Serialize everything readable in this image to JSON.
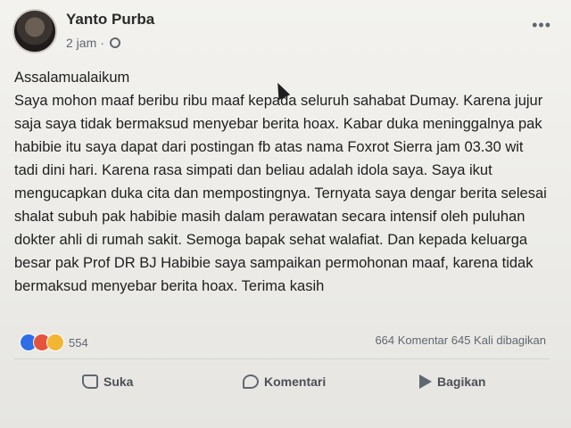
{
  "post": {
    "author": "Yanto Purba",
    "time": "2 jam",
    "more": "•••",
    "text": "Assalamualaikum\nSaya mohon maaf beribu ribu maaf kepada seluruh sahabat Dumay. Karena jujur saja saya tidak bermaksud menyebar berita hoax. Kabar duka meninggalnya pak habibie itu saya dapat dari postingan fb atas nama Foxrot Sierra jam 03.30 wit tadi dini hari. Karena rasa simpati dan beliau adalah idola saya. Saya ikut mengucapkan duka cita dan mempostingnya. Ternyata saya dengar berita selesai shalat subuh pak habibie masih dalam perawatan secara intensif oleh puluhan dokter ahli di rumah sakit. Semoga bapak sehat walafiat. Dan kepada keluarga besar pak Prof DR BJ Habibie saya sampaikan permohonan maaf, karena tidak bermaksud menyebar berita hoax. Terima kasih"
  },
  "stats": {
    "reaction_count": "554",
    "comments": "664 Komentar",
    "shares": "645 Kali dibagikan"
  },
  "actions": {
    "like": "Suka",
    "comment": "Komentari",
    "share": "Bagikan"
  },
  "icons": {
    "reactions": [
      "like-icon",
      "angry-icon",
      "haha-icon"
    ],
    "privacy": "globe-icon"
  }
}
